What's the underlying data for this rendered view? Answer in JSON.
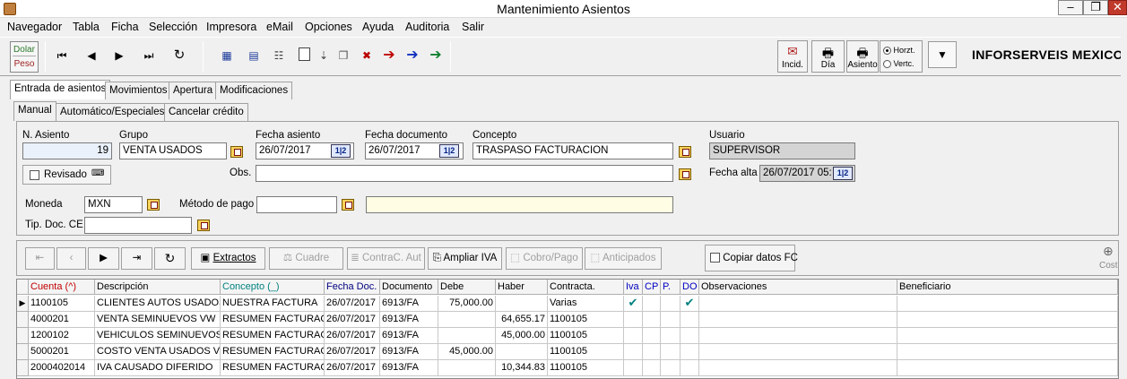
{
  "window": {
    "title": "Mantenimiento Asientos"
  },
  "menu": [
    "Navegador",
    "Tabla",
    "Ficha",
    "Selección",
    "Impresora",
    "eMail",
    "Opciones",
    "Ayuda",
    "Auditoria",
    "Salir"
  ],
  "toolbar": {
    "currency_dolar": "Dolar",
    "currency_peso": "Peso",
    "incid_label": "Incid.",
    "dia_label": "Día",
    "asiento_label": "Asiento",
    "horz_label": "Horzt.",
    "vert_label": "Vertc.",
    "orientation_selected": "Horzt.",
    "company": "INFORSERVEIS MEXICO"
  },
  "tabs": {
    "main": [
      "Entrada de asientos",
      "Movimientos",
      "Apertura",
      "Modificaciones"
    ],
    "main_active": "Entrada de asientos",
    "sub": [
      "Manual",
      "Automático/Especiales",
      "Cancelar crédito"
    ],
    "sub_active": "Manual"
  },
  "form": {
    "n_asiento_label": "N. Asiento",
    "n_asiento": "19",
    "grupo_label": "Grupo",
    "grupo": "VENTA USADOS",
    "fecha_asiento_label": "Fecha asiento",
    "fecha_asiento": "26/07/2017",
    "fecha_documento_label": "Fecha documento",
    "fecha_documento": "26/07/2017",
    "concepto_label": "Concepto",
    "concepto": "TRASPASO FACTURACION",
    "usuario_label": "Usuario",
    "usuario": "SUPERVISOR",
    "revisado_label": "Revisado",
    "obs_label": "Obs.",
    "obs": "",
    "fecha_alta_label": "Fecha alta",
    "fecha_alta": "26/07/2017 05:",
    "moneda_label": "Moneda",
    "moneda": "MXN",
    "metodo_pago_label": "Método de pago",
    "metodo_pago": "",
    "metodo_pago_desc": "",
    "tip_doc_label": "Tip. Doc. CE",
    "tip_doc": "",
    "calendar_glyph": "1|2"
  },
  "grid_toolbar": {
    "extractos": "Extractos",
    "cuadre": "Cuadre",
    "contrac": "ContraC. Aut",
    "ampliar_iva": "Ampliar IVA",
    "cobro_pago": "Cobro/Pago",
    "anticipados": "Anticipados",
    "copiar_datos": "Copiar datos FC",
    "cost_label": "Cost"
  },
  "grid": {
    "columns": [
      "Cuenta (^)",
      "Descripción",
      "Concepto (_)",
      "Fecha Doc.",
      "Documento",
      "Debe",
      "Haber",
      "Contracta.",
      "Iva",
      "CP",
      "P.",
      "DO",
      "Observaciones",
      "Beneficiario"
    ],
    "rows": [
      {
        "cuenta": "1100105",
        "descripcion": "CLIENTES AUTOS USADOS",
        "concepto": "NUESTRA FACTURA",
        "fecha": "26/07/2017",
        "documento": "6913/FA",
        "debe": "75,000.00",
        "haber": "",
        "contracta": "Varias",
        "iva": "✔",
        "cp": "",
        "p": "",
        "do": "✔",
        "obs": "",
        "benef": ""
      },
      {
        "cuenta": "4000201",
        "descripcion": "VENTA SEMINUEVOS VW",
        "concepto": "RESUMEN FACTURAC",
        "fecha": "26/07/2017",
        "documento": "6913/FA",
        "debe": "",
        "haber": "64,655.17",
        "contracta": "1100105",
        "iva": "",
        "cp": "",
        "p": "",
        "do": "",
        "obs": "",
        "benef": ""
      },
      {
        "cuenta": "1200102",
        "descripcion": "VEHICULOS SEMINUEVOS",
        "concepto": "RESUMEN FACTURAC",
        "fecha": "26/07/2017",
        "documento": "6913/FA",
        "debe": "",
        "haber": "45,000.00",
        "contracta": "1100105",
        "iva": "",
        "cp": "",
        "p": "",
        "do": "",
        "obs": "",
        "benef": ""
      },
      {
        "cuenta": "5000201",
        "descripcion": "COSTO VENTA USADOS VW",
        "concepto": "RESUMEN FACTURAC",
        "fecha": "26/07/2017",
        "documento": "6913/FA",
        "debe": "45,000.00",
        "haber": "",
        "contracta": "1100105",
        "iva": "",
        "cp": "",
        "p": "",
        "do": "",
        "obs": "",
        "benef": ""
      },
      {
        "cuenta": "2000402014",
        "descripcion": "IVA CAUSADO DIFERIDO",
        "concepto": "RESUMEN FACTURAC",
        "fecha": "26/07/2017",
        "documento": "6913/FA",
        "debe": "",
        "haber": "10,344.83",
        "contracta": "1100105",
        "iva": "",
        "cp": "",
        "p": "",
        "do": "",
        "obs": "",
        "benef": ""
      }
    ]
  },
  "colors": {
    "cuenta_header": "#c00000",
    "concepto_header": "#008080",
    "fecha_header": "#000080",
    "iva_header": "#0000c0",
    "check": "#008080"
  }
}
